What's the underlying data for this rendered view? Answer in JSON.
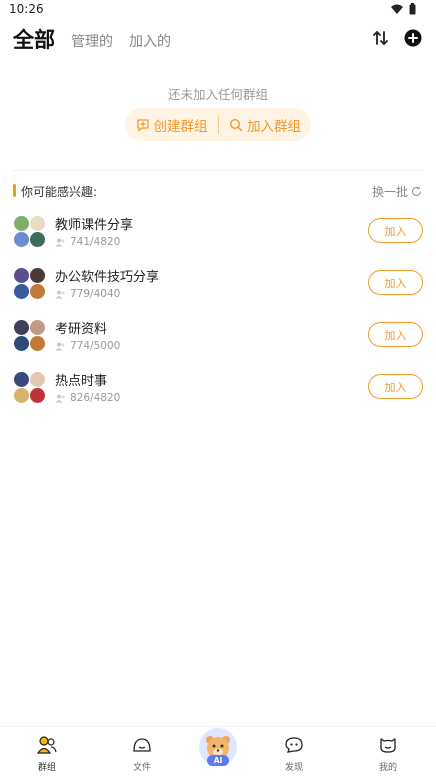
{
  "status_bar": {
    "time": "10:26"
  },
  "tabs": [
    {
      "label": "全部",
      "active": true
    },
    {
      "label": "管理的",
      "active": false
    },
    {
      "label": "加入的",
      "active": false
    }
  ],
  "empty": {
    "message": "还未加入任何群组",
    "create_label": "创建群组",
    "join_label": "加入群组"
  },
  "suggest": {
    "title": "你可能感兴趣:",
    "refresh_label": "换一批"
  },
  "groups": [
    {
      "name": "教师课件分享",
      "members": "741/4820",
      "join_label": "加入",
      "avatar_colors": [
        "#7fae6b",
        "#e9dcc3",
        "#6a8bd0",
        "#3d6b5c"
      ]
    },
    {
      "name": "办公软件技巧分享",
      "members": "779/4040",
      "join_label": "加入",
      "avatar_colors": [
        "#5a4e8c",
        "#4a3a3a",
        "#3b5a9c",
        "#c27a3a"
      ]
    },
    {
      "name": "考研资料",
      "members": "774/5000",
      "join_label": "加入",
      "avatar_colors": [
        "#3f3f5a",
        "#c29a8a",
        "#2f4a7a",
        "#c07a3a"
      ]
    },
    {
      "name": "热点时事",
      "members": "826/4820",
      "join_label": "加入",
      "avatar_colors": [
        "#3a4a7a",
        "#e3c7b5",
        "#d8b36a",
        "#c0323a"
      ]
    }
  ],
  "bottom_nav": {
    "groups": "群组",
    "files": "文件",
    "ai": "AI",
    "discover": "发现",
    "mine": "我的"
  },
  "colors": {
    "accent": "#f09a2a",
    "pill_bg": "#fff4e4"
  }
}
